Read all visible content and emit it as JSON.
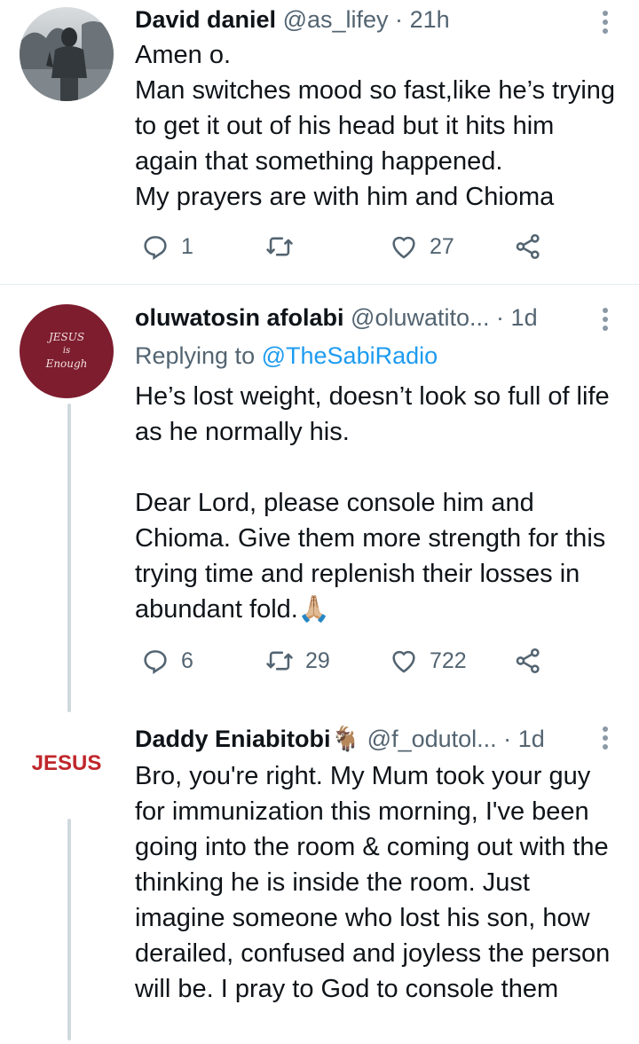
{
  "tweets": [
    {
      "name": "David daniel",
      "handle": "@as_lifey",
      "dot": "·",
      "time": "21h",
      "lines": [
        "Amen o.",
        "Man switches mood so fast,like he’s trying to get it out of his head but it hits him again that something happened.",
        "My prayers are with him and Chioma"
      ],
      "replies": "1",
      "retweets": "",
      "likes": "27"
    },
    {
      "name": "oluwatosin afolabi",
      "handle": "@oluwatito...",
      "dot": "·",
      "time": "1d",
      "avatar_text": [
        "JESUS",
        "is",
        "Enough"
      ],
      "replying_prefix": "Replying to",
      "replying_mention": "@TheSabiRadio",
      "para1": "He’s lost weight, doesn’t look so full of life as he normally his.",
      "para2": "Dear Lord, please console him and Chioma. Give them more strength for this trying time and replenish their losses in abundant fold.🙏🏼",
      "replies": "6",
      "retweets": "29",
      "likes": "722"
    },
    {
      "name": "Daddy Eniabitobi🐐",
      "handle": "@f_odutol...",
      "dot": "·",
      "time": "1d",
      "avatar_text": "JESUS",
      "text": "Bro, you're right. My Mum took your guy for immunization this morning, I've been going into the room & coming out with the thinking he is inside the room. Just imagine someone who lost his son, how derailed, confused and joyless the person will be. I pray to God to console them"
    }
  ],
  "colors": {
    "text": "#0f1419",
    "secondary": "#536471",
    "link": "#1d9bf0",
    "thread_line": "#cfd9de",
    "avatar2_bg": "#7d1d2e",
    "avatar3_text": "#c0262b"
  },
  "icons": [
    "reply-icon",
    "retweet-icon",
    "like-icon",
    "share-icon",
    "more-icon"
  ]
}
